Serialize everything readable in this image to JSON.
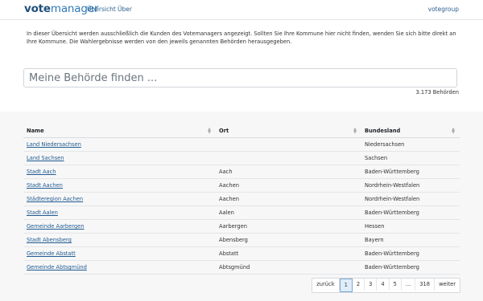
{
  "header": {
    "brand_part1": "vote",
    "brand_part2": "manager",
    "nav": [
      "Übersicht",
      "Über"
    ],
    "right_link": "votegroup"
  },
  "intro": "In dieser Übersicht werden ausschließlich die Kunden des Votemanagers angezeigt. Sollten Sie Ihre Kommune hier nicht finden, wenden Sie sich bitte direkt an Ihre Kommune. Die Wahlergebnisse werden von den jeweils genannten Behörden herausgegeben.",
  "search": {
    "placeholder": "Meine Behörde finden ...",
    "count_label": "3.173 Behörden"
  },
  "table": {
    "columns": [
      "Name",
      "Ort",
      "Bundesland"
    ],
    "rows": [
      [
        "Land Niedersachsen",
        "",
        "Niedersachsen"
      ],
      [
        "Land Sachsen",
        "",
        "Sachsen"
      ],
      [
        "Stadt Aach",
        "Aach",
        "Baden-Württemberg"
      ],
      [
        "Stadt Aachen",
        "Aachen",
        "Nordrhein-Westfalen"
      ],
      [
        "Städteregion Aachen",
        "Aachen",
        "Nordrhein-Westfalen"
      ],
      [
        "Stadt Aalen",
        "Aalen",
        "Baden-Württemberg"
      ],
      [
        "Gemeinde Aarbergen",
        "Aarbergen",
        "Hessen"
      ],
      [
        "Stadt Abensberg",
        "Abensberg",
        "Bayern"
      ],
      [
        "Gemeinde Abstatt",
        "Abstatt",
        "Baden-Württemberg"
      ],
      [
        "Gemeinde Abtsgmünd",
        "Abtsgmünd",
        "Baden-Württemberg"
      ]
    ]
  },
  "pagination": {
    "prev": "zurück",
    "pages": [
      "1",
      "2",
      "3",
      "4",
      "5",
      "...",
      "318"
    ],
    "current": "1",
    "next": "weiter"
  },
  "colors": {
    "brand_dark": "#1f4f7a",
    "brand_light": "#2e79b8",
    "link": "#1f5a8f",
    "background": "#f7f7f8"
  }
}
